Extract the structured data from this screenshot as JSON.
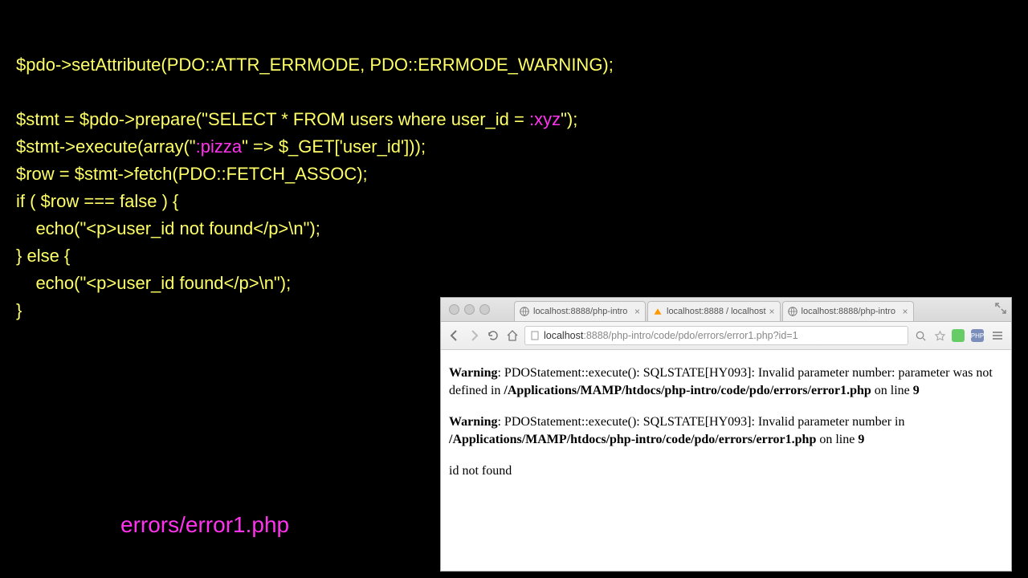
{
  "code": {
    "l1a": "$pdo->setAttribute(PDO::ATTR_ERRMODE, PDO::ERRMODE_WARNING);",
    "l2a": "$stmt = $pdo->prepare(\"SELECT * FROM users where user_id = ",
    "l2b": ":xyz",
    "l2c": "\");",
    "l3a": "$stmt->execute(array(\"",
    "l3b": ":pizza",
    "l3c": "\" => $_GET['user_id']));",
    "l4": "$row = $stmt->fetch(PDO::FETCH_ASSOC);",
    "l5": "if ( $row === false ) {",
    "l6": "    echo(\"<p>user_id not found</p>\\n\");",
    "l7": "} else {",
    "l8": "    echo(\"<p>user_id found</p>\\n\");",
    "l9": "}"
  },
  "caption": "errors/error1.php",
  "browser": {
    "tabs": [
      {
        "label": "localhost:8888/php-intro"
      },
      {
        "label": "localhost:8888 / localhost"
      },
      {
        "label": "localhost:8888/php-intro"
      }
    ],
    "url_host": "localhost",
    "url_path": ":8888/php-intro/code/pdo/errors/error1.php?id=1",
    "page": {
      "warning_label": "Warning",
      "w1_msg": ": PDOStatement::execute(): SQLSTATE[HY093]: Invalid parameter number: parameter was not defined in ",
      "w1_path": "/Applications/MAMP/htdocs/php-intro/code/pdo/errors/error1.php",
      "on_line": " on line ",
      "w1_line": "9",
      "w2_msg": ": PDOStatement::execute(): SQLSTATE[HY093]: Invalid parameter number in ",
      "w2_path": "/Applications/MAMP/htdocs/php-intro/code/pdo/errors/error1.php",
      "w2_line": "9",
      "result": "id not found"
    }
  }
}
